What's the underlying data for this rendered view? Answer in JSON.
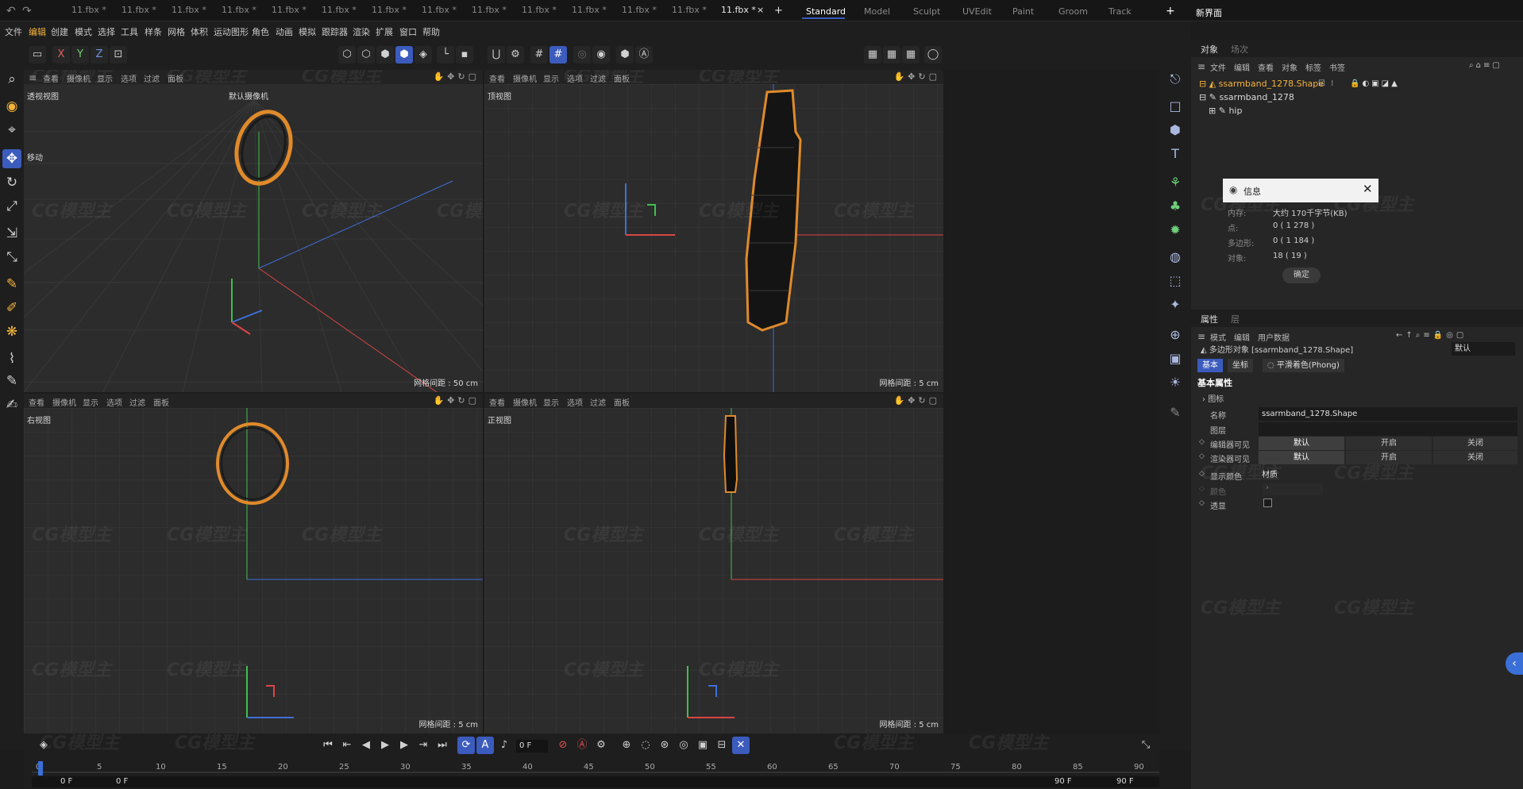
{
  "doc_tabs": [
    "11.fbx *",
    "11.fbx *",
    "11.fbx *",
    "11.fbx *",
    "11.fbx *",
    "11.fbx *",
    "11.fbx *",
    "11.fbx *",
    "11.fbx *",
    "11.fbx *",
    "11.fbx *",
    "11.fbx *",
    "11.fbx *",
    "11.fbx *"
  ],
  "active_tab": "11.fbx *",
  "tab_close": "×",
  "tab_add": "+",
  "layouts": [
    "Standard",
    "Model",
    "Sculpt",
    "UVEdit",
    "Paint",
    "Groom",
    "Track"
  ],
  "active_layout": "Standard",
  "layout_add": "+",
  "new_ui": "新界面",
  "menu": [
    "文件",
    "编辑",
    "创建",
    "模式",
    "选择",
    "工具",
    "样条",
    "网格",
    "体积",
    "运动图形",
    "角色",
    "动画",
    "模拟",
    "跟踪器",
    "渲染",
    "扩展",
    "窗口",
    "帮助"
  ],
  "axis_buttons": [
    "X",
    "Y",
    "Z"
  ],
  "viewport_menu": [
    "查看",
    "摄像机",
    "显示",
    "选项",
    "过滤",
    "面板"
  ],
  "viewports": {
    "perspective": {
      "label": "透视视图",
      "camera": "默认摄像机",
      "tool": "移动",
      "grid": "网格间距 : 50 cm"
    },
    "top": {
      "label": "顶视图",
      "grid": "网格间距 : 5 cm"
    },
    "right": {
      "label": "右视图",
      "grid": "网格间距 : 5 cm"
    },
    "front": {
      "label": "正视图",
      "grid": "网格间距 : 5 cm"
    }
  },
  "watermark": "CG模型主",
  "watermark_url": "www.CGMXW.com",
  "right_panel": {
    "tabs": [
      "对象",
      "场次"
    ],
    "menu": [
      "文件",
      "编辑",
      "查看",
      "对象",
      "标签",
      "书签"
    ],
    "objects": [
      {
        "name": "ssarmband_1278.Shape",
        "selected": true
      },
      {
        "name": "ssarmband_1278",
        "selected": false
      },
      {
        "name": "hip",
        "selected": false
      }
    ]
  },
  "info_dialog": {
    "title": "信息",
    "rows": [
      {
        "k": "内存:",
        "v": "大约 170千字节(KB)"
      },
      {
        "k": "点:",
        "v": "0 ( 1 278 )"
      },
      {
        "k": "多边形:",
        "v": "0 ( 1 184 )"
      },
      {
        "k": "对象:",
        "v": "18 ( 19 )"
      }
    ],
    "ok": "确定"
  },
  "attributes": {
    "tabs": [
      "属性",
      "层"
    ],
    "menu": [
      "模式",
      "编辑",
      "用户数据"
    ],
    "object_title": "多边形对象 [ssarmband_1278.Shape]",
    "preset": "默认",
    "subtabs": [
      "基本",
      "坐标",
      "平滑着色(Phong)"
    ],
    "section": "基本属性",
    "icon_label": "图标",
    "name_label": "名称",
    "name_value": "ssarmband_1278.Shape",
    "layer_label": "图层",
    "editor_visible": "编辑器可见",
    "render_visible": "渲染器可见",
    "vis_options": [
      "默认",
      "开启",
      "关闭"
    ],
    "display_color_label": "显示颜色",
    "display_color_value": "材质",
    "color_label": "颜色",
    "xray_label": "透显"
  },
  "timeline": {
    "ticks": [
      "0",
      "5",
      "10",
      "15",
      "20",
      "25",
      "30",
      "35",
      "40",
      "45",
      "50",
      "55",
      "60",
      "65",
      "70",
      "75",
      "80",
      "85",
      "90"
    ],
    "current_frame": "0 F",
    "start": "0 F",
    "start2": "0 F",
    "end": "90 F",
    "end2": "90 F"
  },
  "colors": {
    "accent": "#3b5bbd",
    "selection": "#f4b33a",
    "x_axis": "#d94545",
    "y_axis": "#3fbf4f",
    "z_axis": "#3e6fd8"
  }
}
